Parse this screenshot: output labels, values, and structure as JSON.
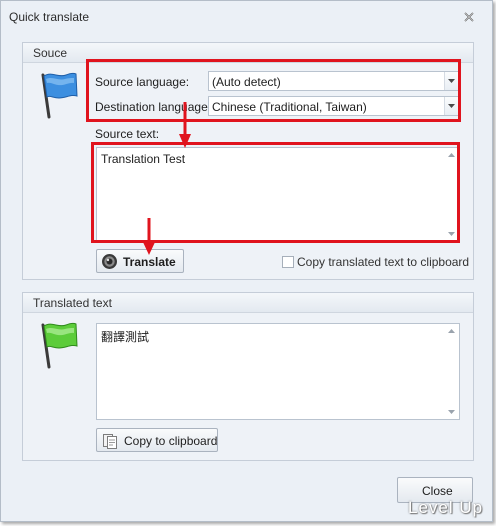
{
  "window": {
    "title": "Quick translate"
  },
  "source_group": {
    "title": "Souce",
    "source_language_label": "Source language:",
    "source_language_value": "(Auto detect)",
    "destination_language_label": "Destination language:",
    "destination_language_value": "Chinese (Traditional, Taiwan)",
    "source_text_label": "Source text:",
    "source_text_value": "Translation Test",
    "translate_button": "Translate",
    "copy_checkbox_label": "Copy translated text to clipboard",
    "copy_checkbox_checked": false
  },
  "translated_group": {
    "title": "Translated text",
    "translated_value": "翻譯測試",
    "copy_button": "Copy to clipboard"
  },
  "footer": {
    "close_button": "Close"
  },
  "watermark": "Level Up",
  "icons": {
    "source_flag": "blue-flag-icon",
    "translated_flag": "green-flag-icon",
    "translate_button_icon": "speaker-icon",
    "copy_button_icon": "clipboard-icon",
    "close_icon": "close-icon"
  },
  "colors": {
    "highlight": "#e0141e",
    "source_flag": "#3c8fe0",
    "translated_flag": "#5ccc3a"
  }
}
